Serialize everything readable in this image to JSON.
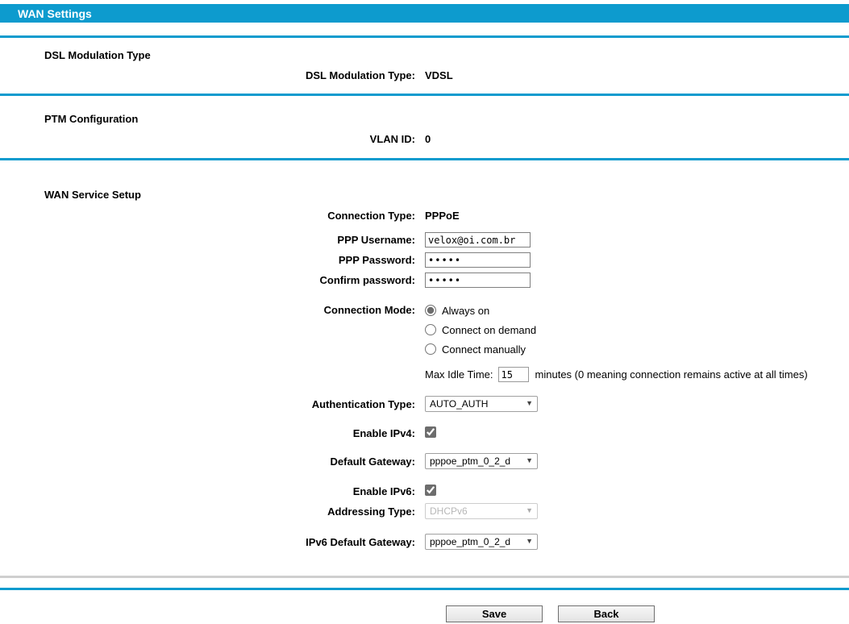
{
  "colors": {
    "accent": "#0d9bce",
    "separator_gray": "#cfcfcf"
  },
  "header": {
    "title": "WAN Settings"
  },
  "sections": {
    "dsl": {
      "heading": "DSL Modulation Type",
      "row_label": "DSL Modulation Type:",
      "row_value": "VDSL"
    },
    "ptm": {
      "heading": "PTM Configuration",
      "row_label": "VLAN ID:",
      "row_value": "0"
    },
    "wan": {
      "heading": "WAN Service Setup",
      "connection_type_label": "Connection Type:",
      "connection_type_value": "PPPoE",
      "ppp_username_label": "PPP Username:",
      "ppp_username_value": "velox@oi.com.br",
      "ppp_password_label": "PPP Password:",
      "ppp_password_value": "•••••",
      "confirm_password_label": "Confirm password:",
      "confirm_password_value": "•••••",
      "connection_mode_label": "Connection Mode:",
      "connection_mode_options": [
        "Always on",
        "Connect on demand",
        "Connect manually"
      ],
      "connection_mode_checked": [
        true,
        false,
        false
      ],
      "max_idle_label": "Max Idle Time:",
      "max_idle_value": "15",
      "max_idle_suffix": "minutes (0 meaning connection remains active at all times)",
      "auth_type_label": "Authentication Type:",
      "auth_type_value": "AUTO_AUTH",
      "enable_ipv4_label": "Enable IPv4:",
      "enable_ipv4_checked": true,
      "default_gateway_label": "Default Gateway:",
      "default_gateway_value": "pppoe_ptm_0_2_d",
      "enable_ipv6_label": "Enable IPv6:",
      "enable_ipv6_checked": true,
      "addressing_type_label": "Addressing Type:",
      "addressing_type_value": "DHCPv6",
      "addressing_type_disabled": true,
      "ipv6_gateway_label": "IPv6 Default Gateway:",
      "ipv6_gateway_value": "pppoe_ptm_0_2_d"
    }
  },
  "footer": {
    "save_label": "Save",
    "back_label": "Back"
  },
  "icons": {
    "dropdown_arrow": "▼"
  }
}
